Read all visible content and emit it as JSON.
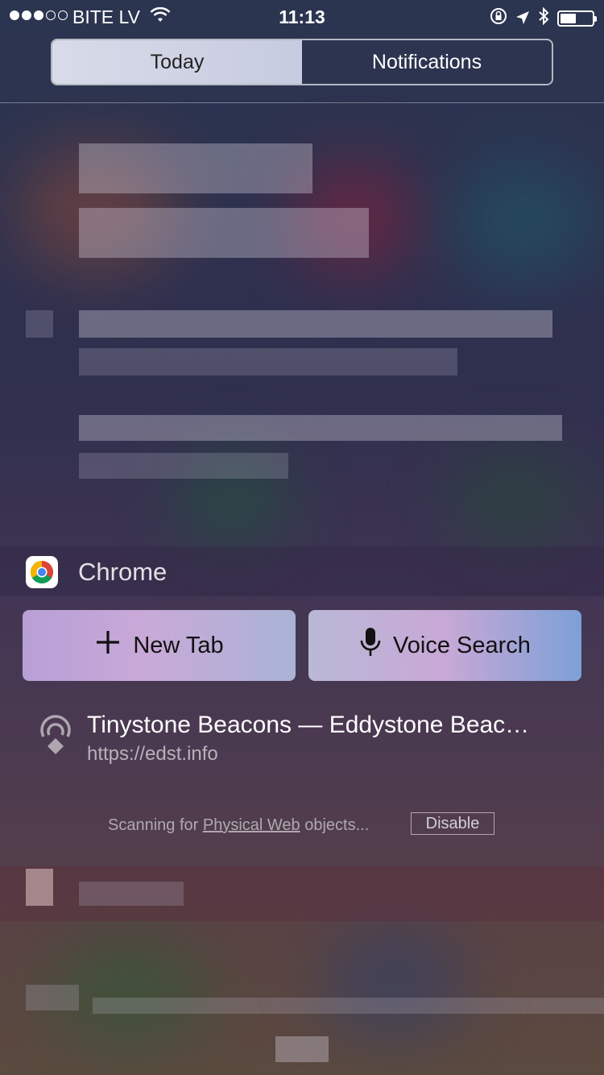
{
  "status_bar": {
    "carrier": "BITE LV",
    "time": "11:13",
    "signal_bars_filled": 3,
    "signal_bars_total": 5,
    "battery_level": 0.45
  },
  "segmented_control": {
    "tabs": [
      {
        "label": "Today",
        "selected": true
      },
      {
        "label": "Notifications",
        "selected": false
      }
    ]
  },
  "widget": {
    "app_name": "Chrome",
    "icon": "chrome-logo-icon",
    "buttons": {
      "new_tab": {
        "label": "New Tab",
        "icon": "plus-icon"
      },
      "voice_search": {
        "label": "Voice Search",
        "icon": "microphone-icon"
      }
    },
    "beacon_item": {
      "title": "Tinystone Beacons — Eddystone Beac…",
      "url": "https://edst.info",
      "icon": "physical-web-icon"
    },
    "footer": {
      "text_before": "Scanning for ",
      "link": "Physical Web",
      "text_after": " objects...",
      "disable_label": "Disable"
    }
  },
  "colors": {
    "selected_tab_bg": "#d8dbe8",
    "new_tab_button": "#b79fd6",
    "voice_button": "#7da0d6"
  }
}
